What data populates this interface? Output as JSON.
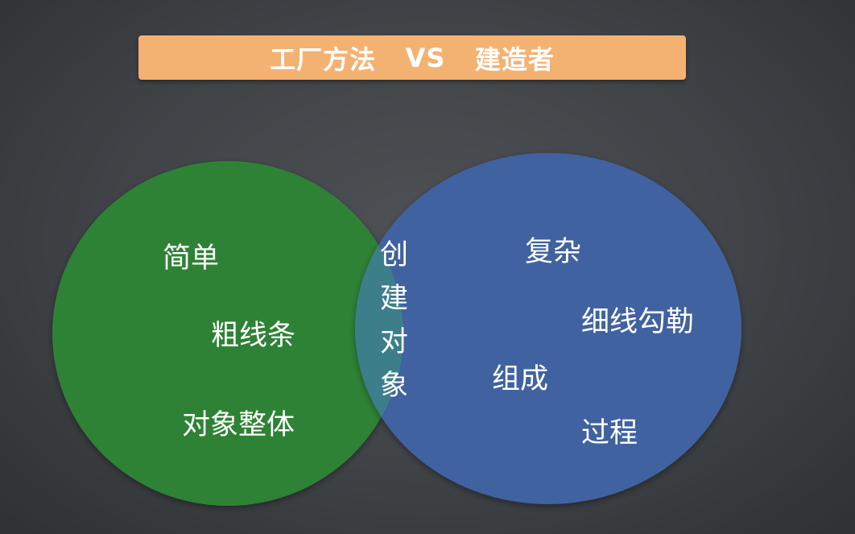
{
  "title": {
    "left": "工厂方法",
    "vs": "VS",
    "right": "建造者"
  },
  "colors": {
    "background": "#404347",
    "title_bar": "#f4b272",
    "left_circle": "#2f8236",
    "right_circle": "#3f62a0",
    "overlap": "#3c7f8a",
    "text": "#ffffff"
  },
  "left_set": {
    "items": [
      "简单",
      "粗线条",
      "对象整体"
    ]
  },
  "overlap": {
    "chars": [
      "创",
      "建",
      "对",
      "象"
    ]
  },
  "right_set": {
    "items": [
      "复杂",
      "细线勾勒",
      "组成",
      "过程"
    ]
  }
}
